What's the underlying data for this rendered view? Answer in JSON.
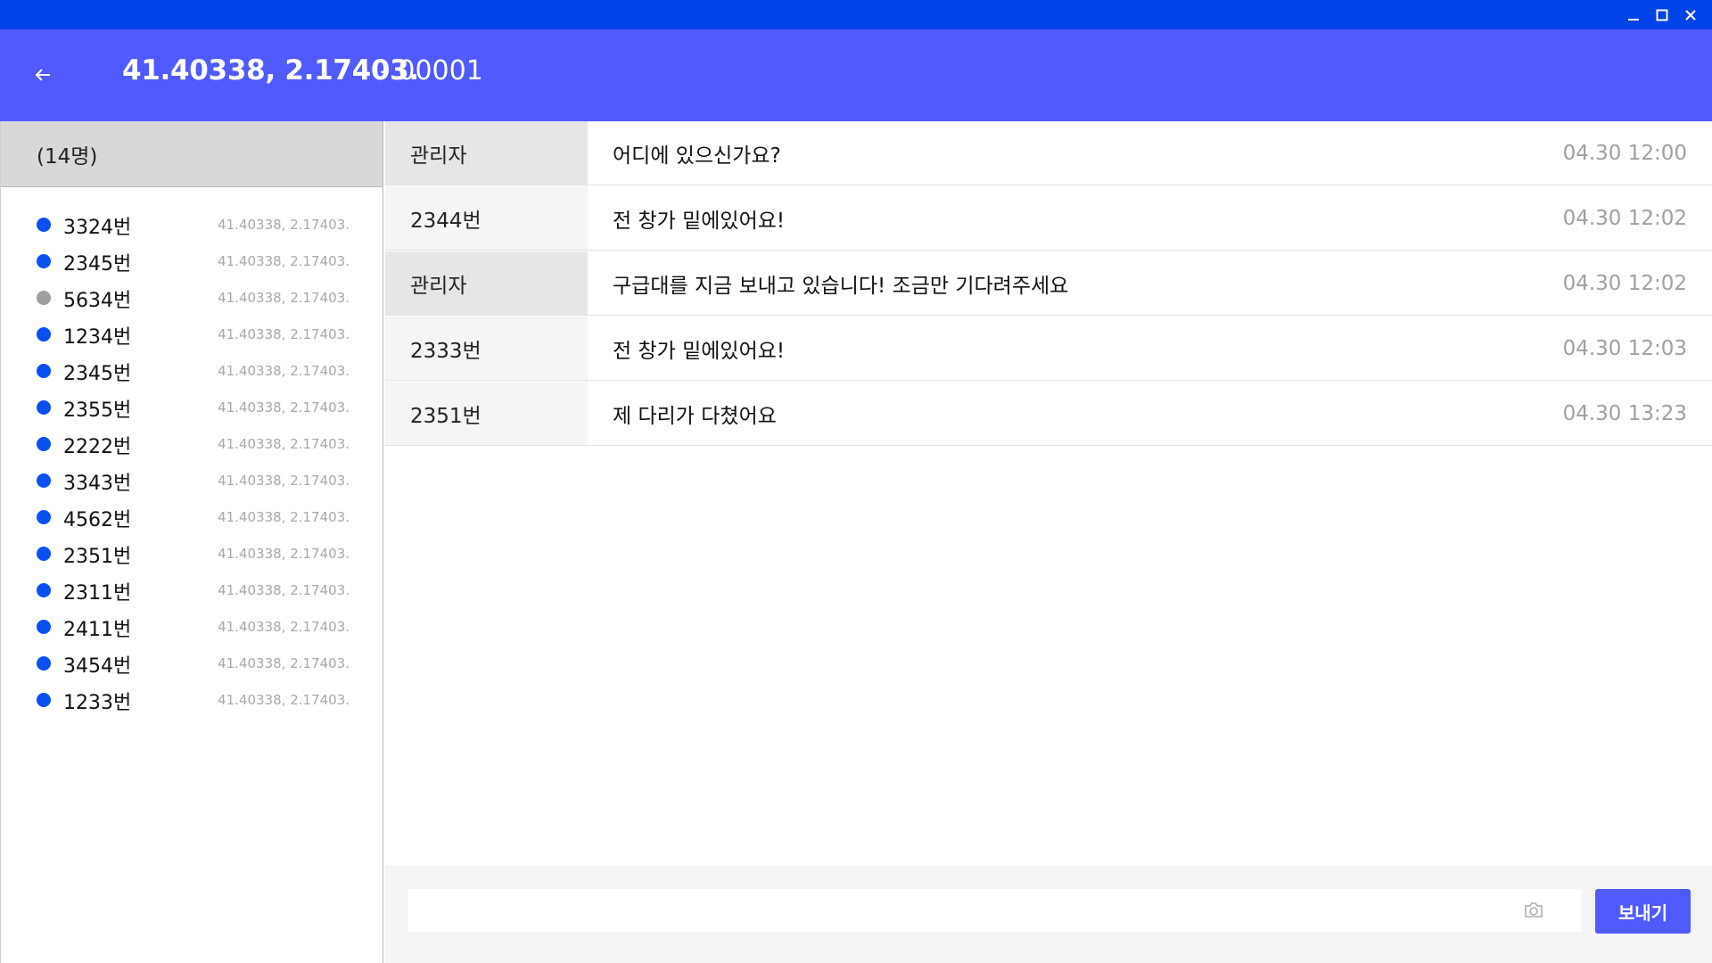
{
  "window": {
    "minimize_icon": "minimize-icon",
    "maximize_icon": "maximize-icon",
    "close_icon": "close-icon",
    "titlebar_color": "#0043e8"
  },
  "header": {
    "title": "41.40338, 2.17403.",
    "code": "- 00001",
    "back_icon": "arrow-left-icon",
    "color": "#505aff"
  },
  "sidebar": {
    "count_label": "(14명)",
    "status_colors": {
      "online": "#0b4ff0",
      "offline": "#9e9e9e"
    },
    "members": [
      {
        "name": "3324번",
        "location": "41.40338, 2.17403.",
        "status": "online"
      },
      {
        "name": "2345번",
        "location": "41.40338, 2.17403.",
        "status": "online"
      },
      {
        "name": "5634번",
        "location": "41.40338, 2.17403.",
        "status": "offline"
      },
      {
        "name": "1234번",
        "location": "41.40338, 2.17403.",
        "status": "online"
      },
      {
        "name": "2345번",
        "location": "41.40338, 2.17403.",
        "status": "online"
      },
      {
        "name": "2355번",
        "location": "41.40338, 2.17403.",
        "status": "online"
      },
      {
        "name": "2222번",
        "location": "41.40338, 2.17403.",
        "status": "online"
      },
      {
        "name": "3343번",
        "location": "41.40338, 2.17403.",
        "status": "online"
      },
      {
        "name": "4562번",
        "location": "41.40338, 2.17403.",
        "status": "online"
      },
      {
        "name": "2351번",
        "location": "41.40338, 2.17403.",
        "status": "online"
      },
      {
        "name": "2311번",
        "location": "41.40338, 2.17403.",
        "status": "online"
      },
      {
        "name": "2411번",
        "location": "41.40338, 2.17403.",
        "status": "online"
      },
      {
        "name": "3454번",
        "location": "41.40338, 2.17403.",
        "status": "online"
      },
      {
        "name": "1233번",
        "location": "41.40338, 2.17403.",
        "status": "online"
      }
    ]
  },
  "chat": {
    "sender_bg": {
      "admin": "#e6e6e6",
      "user": "#f5f5f5"
    },
    "messages": [
      {
        "sender": "관리자",
        "role": "admin",
        "text": "어디에 있으신가요?",
        "time": "04.30  12:00"
      },
      {
        "sender": "2344번",
        "role": "user",
        "text": "전 창가 밑에있어요!",
        "time": "04.30  12:02"
      },
      {
        "sender": "관리자",
        "role": "admin",
        "text": "구급대를 지금 보내고 있습니다! 조금만 기다려주세요",
        "time": "04.30  12:02"
      },
      {
        "sender": "2333번",
        "role": "user",
        "text": "전 창가 밑에있어요!",
        "time": "04.30 12:03"
      },
      {
        "sender": "2351번",
        "role": "user",
        "text": "제 다리가 다쳤어요",
        "time": "04.30 13:23"
      }
    ]
  },
  "composer": {
    "input_value": "",
    "input_placeholder": "",
    "camera_icon": "camera-icon",
    "send_label": "보내기"
  }
}
